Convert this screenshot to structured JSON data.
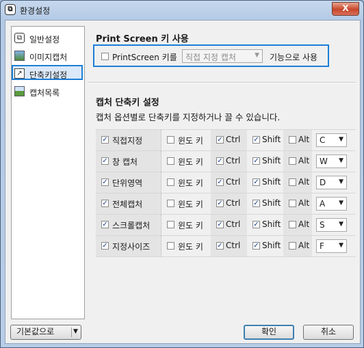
{
  "window": {
    "title": "환경설정",
    "close_label": "X"
  },
  "sidebar": {
    "items": [
      {
        "label": "일반설정",
        "icon": "settings-icon",
        "selected": false
      },
      {
        "label": "이미지캡처",
        "icon": "image-capture-icon",
        "selected": false
      },
      {
        "label": "단축키설정",
        "icon": "shortcut-icon",
        "selected": true
      },
      {
        "label": "캡처목록",
        "icon": "capture-list-icon",
        "selected": false
      }
    ]
  },
  "printscreen": {
    "section_title": "Print Screen 키 사용",
    "checkbox_label": "PrintScreen 키를",
    "checked": false,
    "combo_value": "직접 지정 캡처",
    "suffix": "기능으로 사용"
  },
  "shortcuts": {
    "section_title": "캡처 단축키 설정",
    "description": "캡처 옵션별로 단축키를 지정하거나 끌 수 있습니다.",
    "win_label": "윈도 키",
    "ctrl_label": "Ctrl",
    "shift_label": "Shift",
    "alt_label": "Alt",
    "rows": [
      {
        "name": "직접지정",
        "enabled": true,
        "win": false,
        "ctrl": true,
        "shift": true,
        "alt": false,
        "key": "C"
      },
      {
        "name": "창 캡처",
        "enabled": true,
        "win": false,
        "ctrl": true,
        "shift": true,
        "alt": false,
        "key": "W"
      },
      {
        "name": "단위영역",
        "enabled": true,
        "win": false,
        "ctrl": true,
        "shift": true,
        "alt": false,
        "key": "D"
      },
      {
        "name": "전체캡처",
        "enabled": true,
        "win": false,
        "ctrl": true,
        "shift": true,
        "alt": false,
        "key": "A"
      },
      {
        "name": "스크롤캡처",
        "enabled": true,
        "win": false,
        "ctrl": true,
        "shift": true,
        "alt": false,
        "key": "S"
      },
      {
        "name": "지정사이즈",
        "enabled": true,
        "win": false,
        "ctrl": true,
        "shift": true,
        "alt": false,
        "key": "F"
      }
    ]
  },
  "footer": {
    "default_label": "기본값으로",
    "ok_label": "확인",
    "cancel_label": "취소"
  },
  "colors": {
    "highlight": "#1c7ed6",
    "frame": "#b8cde6",
    "close": "#c7462a"
  }
}
